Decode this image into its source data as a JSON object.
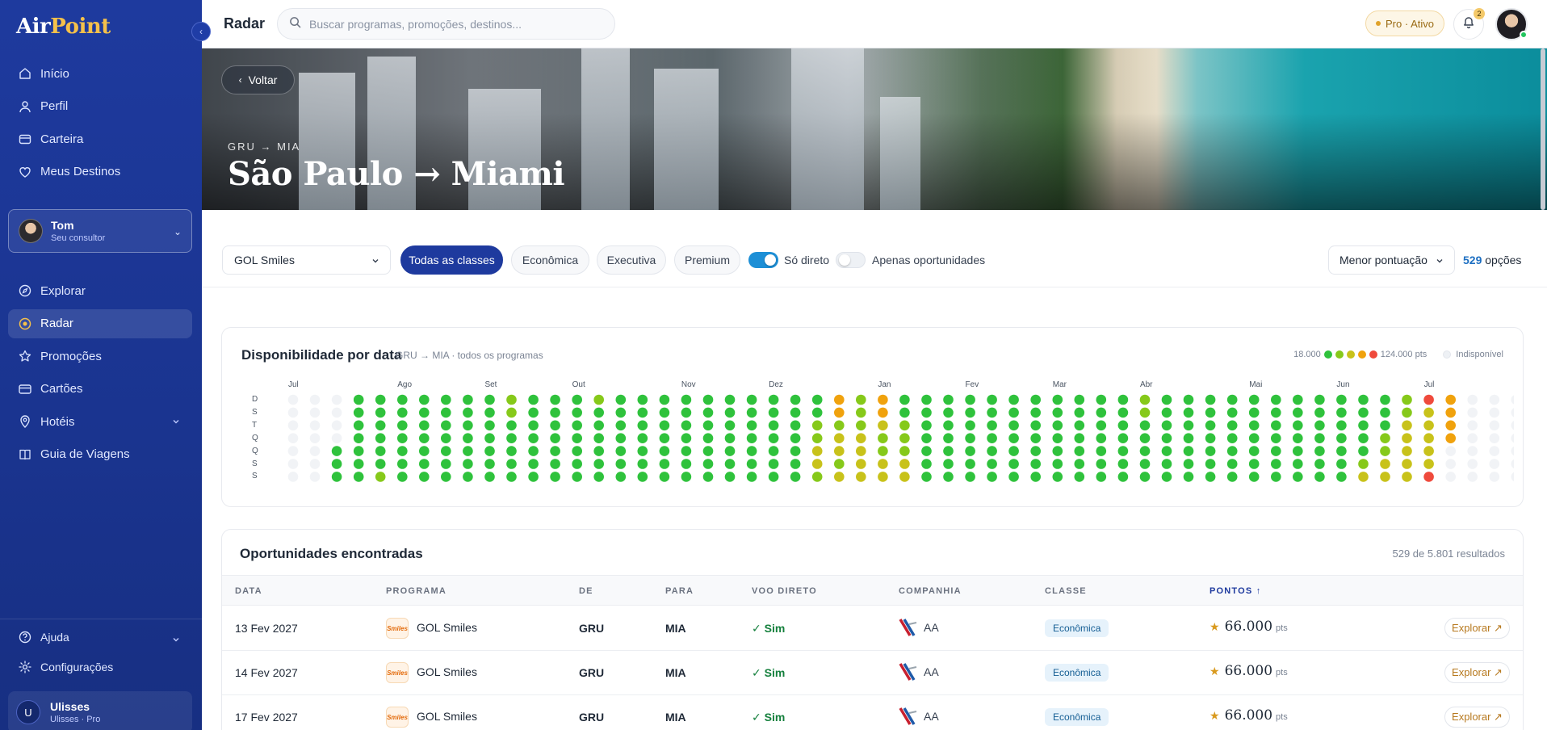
{
  "brand": {
    "part1": "Air",
    "part2": "Point"
  },
  "sidebar": {
    "nav_top": [
      {
        "label": "Início",
        "icon": "home-icon"
      },
      {
        "label": "Perfil",
        "icon": "user-icon"
      },
      {
        "label": "Carteira",
        "icon": "wallet-icon"
      },
      {
        "label": "Meus Destinos",
        "icon": "heart-icon"
      }
    ],
    "consultant": {
      "name": "Tom",
      "role": "Seu consultor"
    },
    "nav_main": [
      {
        "label": "Explorar",
        "icon": "compass-icon"
      },
      {
        "label": "Radar",
        "icon": "radar-icon",
        "active": true
      },
      {
        "label": "Promoções",
        "icon": "star-icon"
      },
      {
        "label": "Cartões",
        "icon": "card-icon"
      },
      {
        "label": "Hotéis",
        "icon": "pin-icon",
        "has_submenu": true
      },
      {
        "label": "Guia de Viagens",
        "icon": "book-icon"
      }
    ],
    "nav_bottom": [
      {
        "label": "Ajuda",
        "icon": "help-icon",
        "has_submenu": true
      },
      {
        "label": "Configurações",
        "icon": "settings-icon"
      }
    ],
    "user": {
      "initial": "U",
      "name": "Ulisses",
      "role": "Ulisses · Pro"
    }
  },
  "topbar": {
    "title": "Radar",
    "search_placeholder": "Buscar programas, promoções, destinos...",
    "plan_badge": "Pro · Ativo",
    "notifications_count": "2"
  },
  "hero": {
    "back_label": "Voltar",
    "route_code": "GRU → MIA",
    "route_title": "São Paulo → Miami"
  },
  "filters": {
    "program": "GOL Smiles",
    "classes": [
      "Todas as classes",
      "Econômica",
      "Executiva",
      "Premium"
    ],
    "active_class": "Todas as classes",
    "direct_label": "Só direto",
    "direct_on": true,
    "opportunities_label": "Apenas oportunidades",
    "opportunities_on": false,
    "sort": "Menor pontuação",
    "options_count": "529",
    "options_label": "opções"
  },
  "availability": {
    "title": "Disponibilidade por data",
    "subtitle": "GRU → MIA · todos os programas",
    "legend_min": "18.000",
    "legend_max": "124.000 pts",
    "legend_unavailable": "Indisponível",
    "months": [
      "Jul",
      "Ago",
      "Set",
      "Out",
      "Nov",
      "Dez",
      "Jan",
      "Fev",
      "Mar",
      "Abr",
      "Mai",
      "Jun",
      "Jul"
    ],
    "month_week_index": [
      0,
      5,
      9,
      13,
      18,
      22,
      27,
      31,
      35,
      39,
      44,
      48,
      52
    ],
    "days": [
      "D",
      "S",
      "T",
      "Q",
      "Q",
      "S",
      "S"
    ],
    "colors": {
      "0": "#f1f3f6",
      "1": "#2fc23c",
      "2": "#86c91a",
      "3": "#c8c21a",
      "4": "#f0a20d",
      "5": "#ef4a3c"
    },
    "legend_colors": [
      "#2fc23c",
      "#86c91a",
      "#c8c21a",
      "#f0a20d",
      "#ef4a3c"
    ],
    "weeks": [
      "0000000",
      "0000000",
      "0000111",
      "1111111",
      "1111112",
      "1111111",
      "1111111",
      "1111111",
      "1111111",
      "1111111",
      "2211111",
      "1111111",
      "1111111",
      "1111111",
      "2111111",
      "1111111",
      "1111111",
      "1111111",
      "1111111",
      "1111111",
      "1111111",
      "1111111",
      "1111111",
      "1111111",
      "1122332",
      "4423323",
      "2223333",
      "4432233",
      "1122233",
      "1111111",
      "1111111",
      "1111111",
      "1111111",
      "1111111",
      "1111111",
      "1111111",
      "1111111",
      "1111111",
      "1111111",
      "2211111",
      "1111111",
      "1111111",
      "1111111",
      "1111111",
      "1111111",
      "1111111",
      "1111111",
      "1111111",
      "1111111",
      "1111123",
      "1112233",
      "2233333",
      "5333335",
      "4444000",
      "0000000",
      "0000000",
      "0000000"
    ]
  },
  "opportunities": {
    "title": "Oportunidades encontradas",
    "count_label": "529 de 5.801 resultados",
    "columns": [
      "DATA",
      "PROGRAMA",
      "DE",
      "PARA",
      "VOO DIRETO",
      "COMPANHIA",
      "CLASSE",
      "PONTOS ↑"
    ],
    "sorted_column": "PONTOS ↑",
    "rows": [
      {
        "date": "13 Fev 2027",
        "program": "GOL Smiles",
        "from": "GRU",
        "to": "MIA",
        "direct": "Sim",
        "airline": "AA",
        "class": "Econômica",
        "points": "66.000",
        "unit": "pts",
        "action": "Explorar ↗"
      },
      {
        "date": "14 Fev 2027",
        "program": "GOL Smiles",
        "from": "GRU",
        "to": "MIA",
        "direct": "Sim",
        "airline": "AA",
        "class": "Econômica",
        "points": "66.000",
        "unit": "pts",
        "action": "Explorar ↗"
      },
      {
        "date": "17 Fev 2027",
        "program": "GOL Smiles",
        "from": "GRU",
        "to": "MIA",
        "direct": "Sim",
        "airline": "AA",
        "class": "Econômica",
        "points": "66.000",
        "unit": "pts",
        "action": "Explorar ↗"
      }
    ],
    "program_logo_text": "Smiles"
  }
}
